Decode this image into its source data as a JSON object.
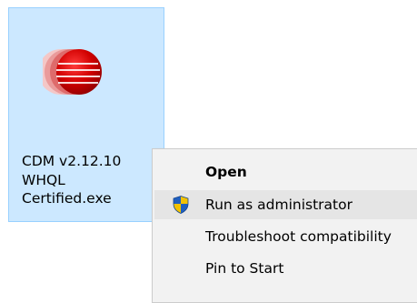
{
  "desktop": {
    "file": {
      "name_lines": [
        "CDM v2.12.10",
        "WHQL",
        "Certified.exe"
      ],
      "icon": "ftdi-red-sphere-icon",
      "selected": true
    }
  },
  "context_menu": {
    "items": [
      {
        "label": "Open",
        "bold": true,
        "icon": null
      },
      {
        "label": "Run as administrator",
        "bold": false,
        "icon": "uac-shield-icon",
        "highlighted": true
      },
      {
        "label": "Troubleshoot compatibility",
        "bold": false,
        "icon": null
      },
      {
        "label": "Pin to Start",
        "bold": false,
        "icon": null
      }
    ]
  },
  "colors": {
    "selection_fill": "#cce8ff",
    "selection_border": "#99d1ff",
    "menu_background": "#f2f2f2",
    "menu_hover": "#e5e5e5",
    "icon_red": "#cc0000",
    "shield_blue": "#1f5fbf",
    "shield_yellow": "#f2c200"
  }
}
